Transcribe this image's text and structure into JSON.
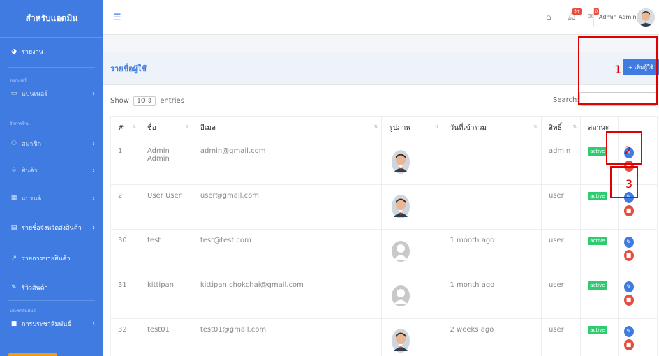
{
  "sidebar": {
    "brand": "สำหรับแอดมิน",
    "report": "รายงาน",
    "group1": "ดอกเตอร์",
    "banners": "แบนเนอร์",
    "group2": "จัดการร้าน",
    "members": "สมาชิก",
    "products": "สินค้า",
    "brands": "แบรนด์",
    "shipping": "รายชื่อจังหวัดส่งสินค้า",
    "sales": "รายการขายสินค้า",
    "reviews": "รีวิวสินค้า",
    "group3": "ประชาสัมพันธ์",
    "pr": "การประชาสัมพันธ์"
  },
  "topbar": {
    "bell_badge": "5+",
    "mail_badge": "0",
    "username": "Admin Admin"
  },
  "page": {
    "title": "รายชื่อผู้ใช้",
    "add_button": "+ เพิ่มผู้ใช้"
  },
  "table_controls": {
    "show_label": "Show",
    "entries_value": "10",
    "entries_label": "entries",
    "search_label": "Search:",
    "search_value": ""
  },
  "table": {
    "headers": [
      "#",
      "ชื่อ",
      "อีเมล",
      "รูปภาพ",
      "วันที่เข้าร่วม",
      "สิทธิ์",
      "สถานะ",
      ""
    ],
    "rows": [
      {
        "id": "1",
        "name": "Admin Admin",
        "email": "admin@gmail.com",
        "photo": "man-avatar",
        "joined": "",
        "role": "admin",
        "status": "active"
      },
      {
        "id": "2",
        "name": "User User",
        "email": "user@gmail.com",
        "photo": "man-avatar",
        "joined": "",
        "role": "user",
        "status": "active"
      },
      {
        "id": "30",
        "name": "test",
        "email": "test@test.com",
        "photo": "default-avatar",
        "joined": "1 month ago",
        "role": "user",
        "status": "active"
      },
      {
        "id": "31",
        "name": "kittipan",
        "email": "kittipan.chokchai@gmail.com",
        "photo": "default-avatar",
        "joined": "1 month ago",
        "role": "user",
        "status": "active"
      },
      {
        "id": "32",
        "name": "test01",
        "email": "test01@gmail.com",
        "photo": "man-avatar",
        "joined": "2 weeks ago",
        "role": "user",
        "status": "active"
      }
    ]
  },
  "annotations": [
    "1",
    "2",
    "3"
  ],
  "colors": {
    "primary": "#3f7be0",
    "danger": "#e74c3c",
    "success": "#2ecc71",
    "annotation": "#e00000"
  }
}
